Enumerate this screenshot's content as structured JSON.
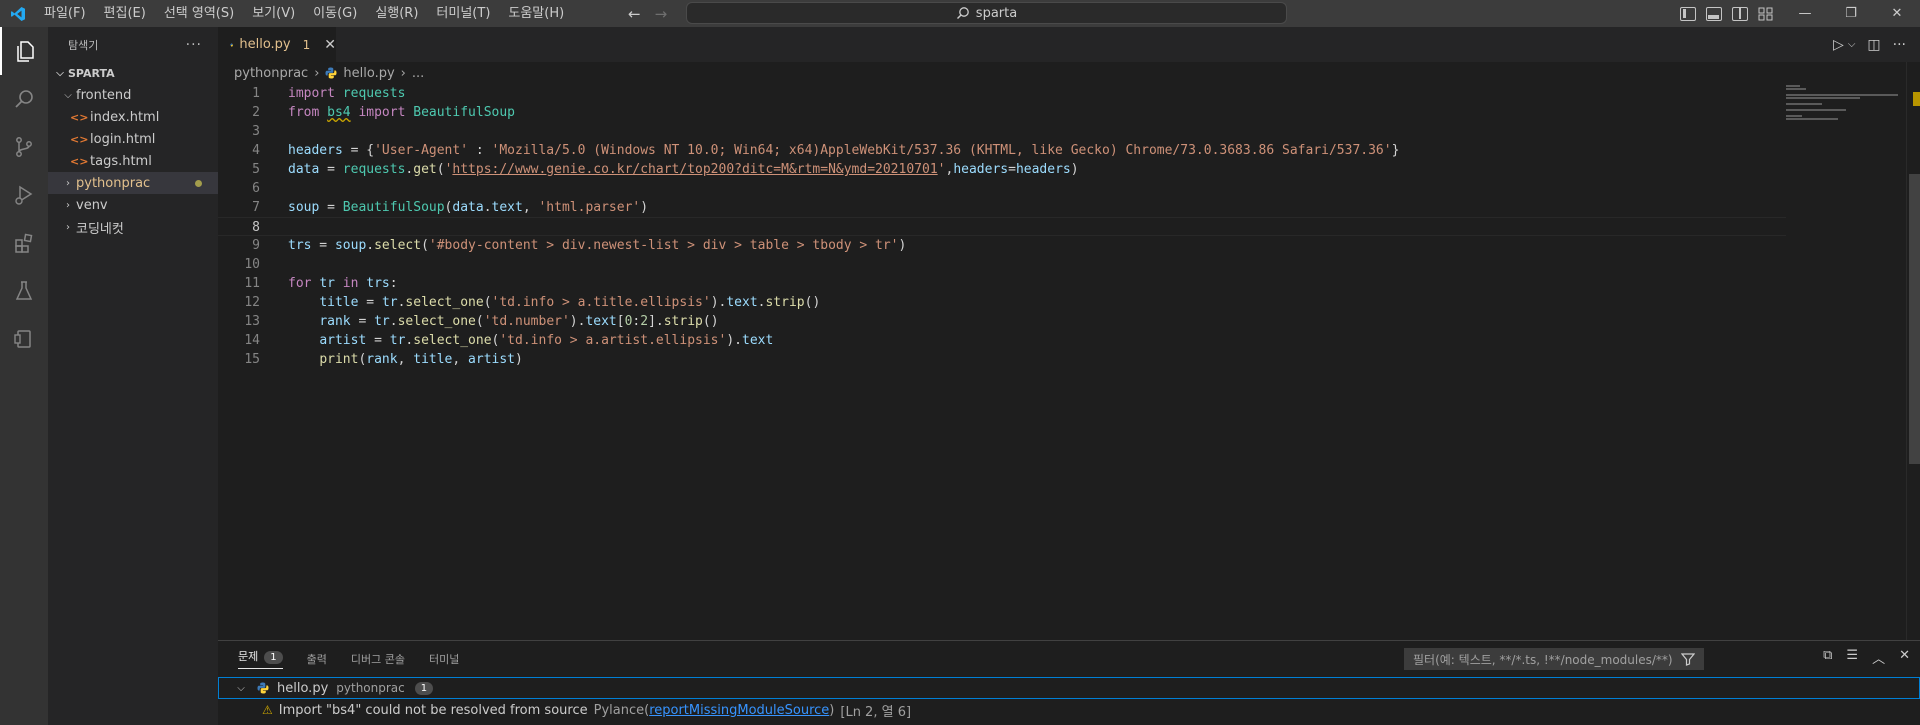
{
  "titlebar": {
    "menu": [
      "파일(F)",
      "편집(E)",
      "선택 영역(S)",
      "보기(V)",
      "이동(G)",
      "실행(R)",
      "터미널(T)",
      "도움말(H)"
    ],
    "search": "sparta"
  },
  "sidebar": {
    "title": "탐색기",
    "root": "SPARTA",
    "items": [
      {
        "label": "frontend"
      },
      {
        "label": "index.html"
      },
      {
        "label": "login.html"
      },
      {
        "label": "tags.html"
      },
      {
        "label": "pythonprac"
      },
      {
        "label": "venv"
      },
      {
        "label": "코딩네컷"
      }
    ]
  },
  "tab": {
    "name": "hello.py",
    "count": "1"
  },
  "breadcrumb": {
    "folder": "pythonprac",
    "file": "hello.py",
    "more": "..."
  },
  "code": {
    "line_numbers": [
      "1",
      "2",
      "3",
      "4",
      "5",
      "6",
      "7",
      "8",
      "9",
      "10",
      "11",
      "12",
      "13",
      "14",
      "15"
    ]
  },
  "panel": {
    "tabs": [
      "문제",
      "출력",
      "디버그 콘솔",
      "터미널"
    ],
    "problems_count": "1",
    "filter_placeholder": "필터(예: 텍스트, **/*.ts, !**/node_modules/**)",
    "file": "hello.py",
    "folder": "pythonprac",
    "file_count": "1",
    "message": "Import \"bs4\" could not be resolved from source",
    "source": "Pylance",
    "rule": "reportMissingModuleSource",
    "position": "[Ln 2, 열 6]"
  },
  "colors": {
    "accent": "#007fd4",
    "warning": "#cca700",
    "modified": "#e2c08d"
  }
}
